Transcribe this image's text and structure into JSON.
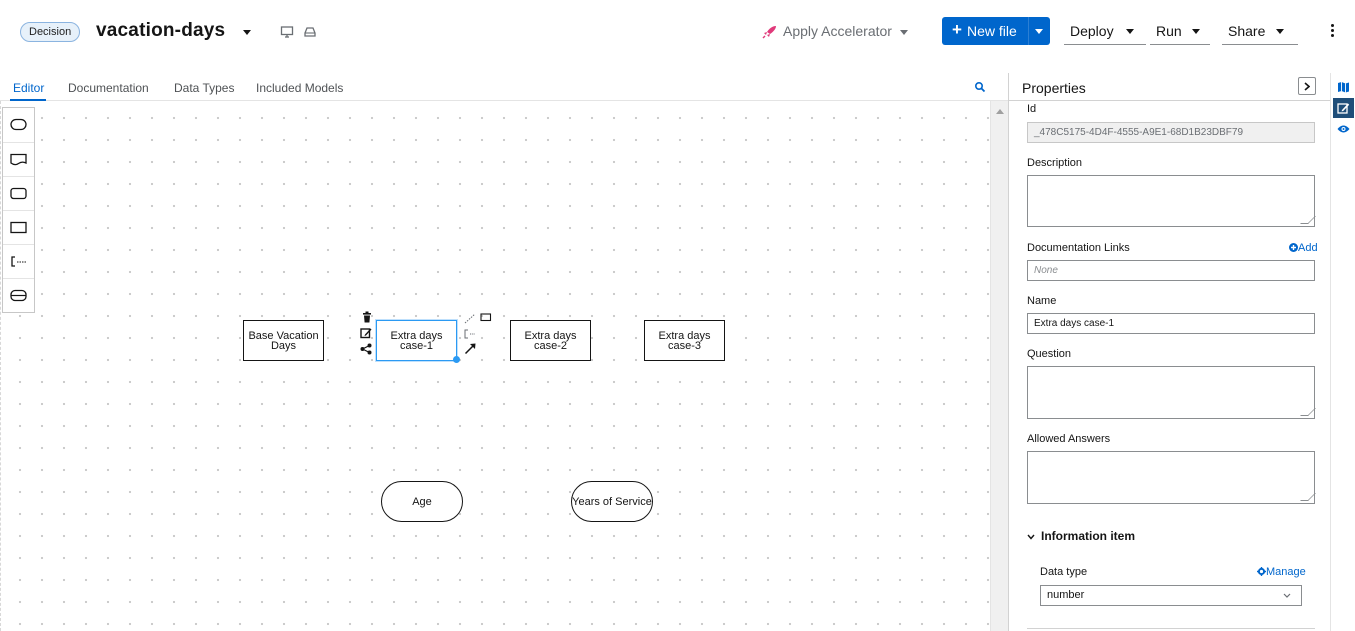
{
  "header": {
    "badge": "Decision",
    "file_name": "vacation-days",
    "accelerator_label": "Apply Accelerator",
    "new_file_label": "New file",
    "deploy_label": "Deploy",
    "run_label": "Run",
    "share_label": "Share",
    "colors": {
      "primary": "#0066cc",
      "rocket": "#e0397a"
    }
  },
  "tabs": [
    {
      "label": "Editor",
      "active": true
    },
    {
      "label": "Documentation",
      "active": false
    },
    {
      "label": "Data Types",
      "active": false
    },
    {
      "label": "Included Models",
      "active": false
    }
  ],
  "palette": [
    "input-data-icon",
    "knowledge-source-icon",
    "bkm-icon",
    "decision-icon",
    "text-annotation-icon",
    "decision-service-icon"
  ],
  "nodes": {
    "decision_base": "Base Vacation Days",
    "decision_case1": "Extra days case-1",
    "decision_case2": "Extra days case-2",
    "decision_case3": "Extra days case-3",
    "input_age": "Age",
    "input_years": "Years of Service"
  },
  "properties": {
    "title": "Properties",
    "id_label": "Id",
    "id_value": "_478C5175-4D4F-4555-A9E1-68D1B23DBF79",
    "description_label": "Description",
    "doc_links_label": "Documentation Links",
    "doc_links_add": "Add",
    "doc_links_placeholder": "None",
    "name_label": "Name",
    "name_value": "Extra days case-1",
    "question_label": "Question",
    "allowed_answers_label": "Allowed Answers",
    "info_item_label": "Information item",
    "data_type_label": "Data type",
    "data_type_manage": "Manage",
    "data_type_value": "number"
  }
}
